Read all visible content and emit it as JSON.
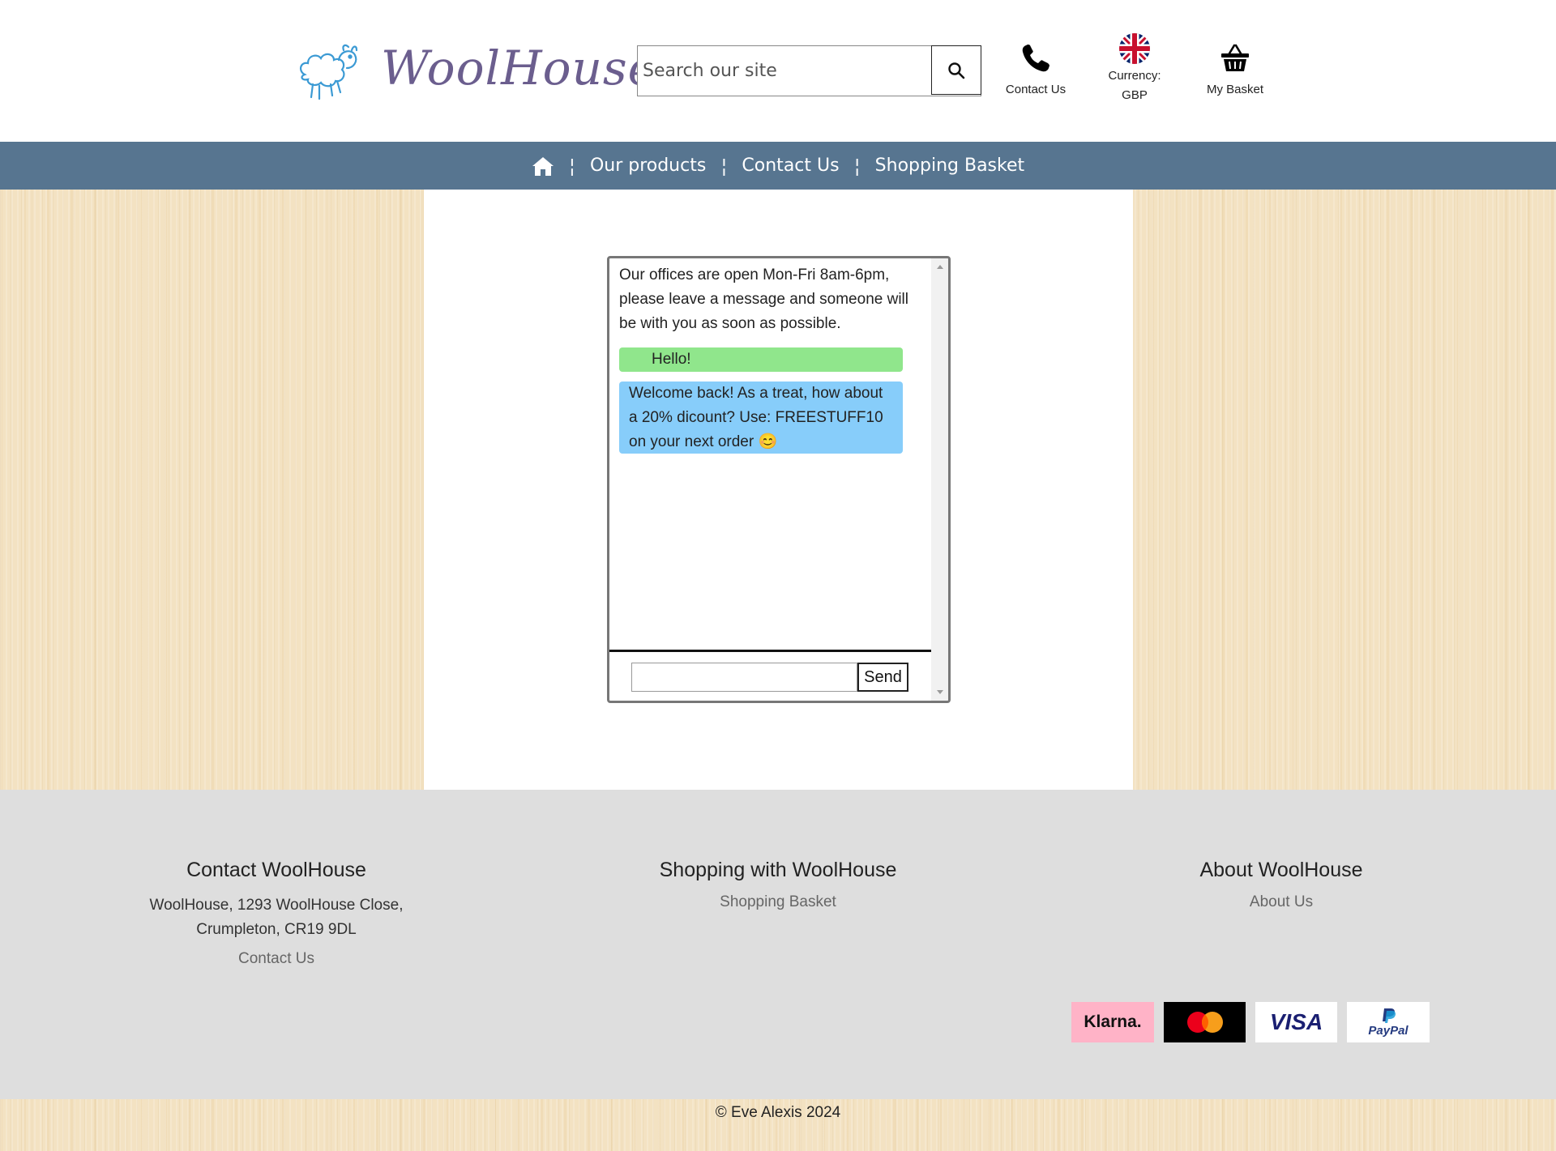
{
  "header": {
    "brand": "WoolHouse",
    "search": {
      "placeholder": "Search our site",
      "value": ""
    },
    "contact_label": "Contact Us",
    "currency_label": "Currency:",
    "currency_value": "GBP",
    "basket_label": "My Basket"
  },
  "nav": {
    "items": [
      {
        "label": "Our products"
      },
      {
        "label": "Contact Us"
      },
      {
        "label": "Shopping Basket"
      }
    ],
    "separator": "¦"
  },
  "chat": {
    "intro": "Our offices are open Mon-Fri 8am-6pm, please leave a message and someone will be with you as soon as possible.",
    "messages": [
      {
        "from": "user",
        "text": "Hello!"
      },
      {
        "from": "bot",
        "text": "Welcome back! As a treat, how about a 20% dicount? Use: FREESTUFF10 on your next order 😊"
      }
    ],
    "input_value": "",
    "send_label": "Send"
  },
  "footer": {
    "contact": {
      "heading": "Contact WoolHouse",
      "address": "WoolHouse, 1293 WoolHouse Close, Crumpleton, CR19 9DL",
      "link": "Contact Us"
    },
    "shopping": {
      "heading": "Shopping with WoolHouse",
      "link": "Shopping Basket"
    },
    "about": {
      "heading": "About WoolHouse",
      "link": "About Us"
    },
    "payments": {
      "klarna": "Klarna.",
      "visa": "VISA",
      "paypal": "PayPal"
    },
    "copyright": "© Eve Alexis 2024"
  },
  "colors": {
    "nav_bg": "#577590",
    "user_bubble": "#90e68c",
    "bot_bubble": "#87cdfa",
    "footer_bg": "#dedede",
    "brand_text": "#6b5e8e"
  }
}
